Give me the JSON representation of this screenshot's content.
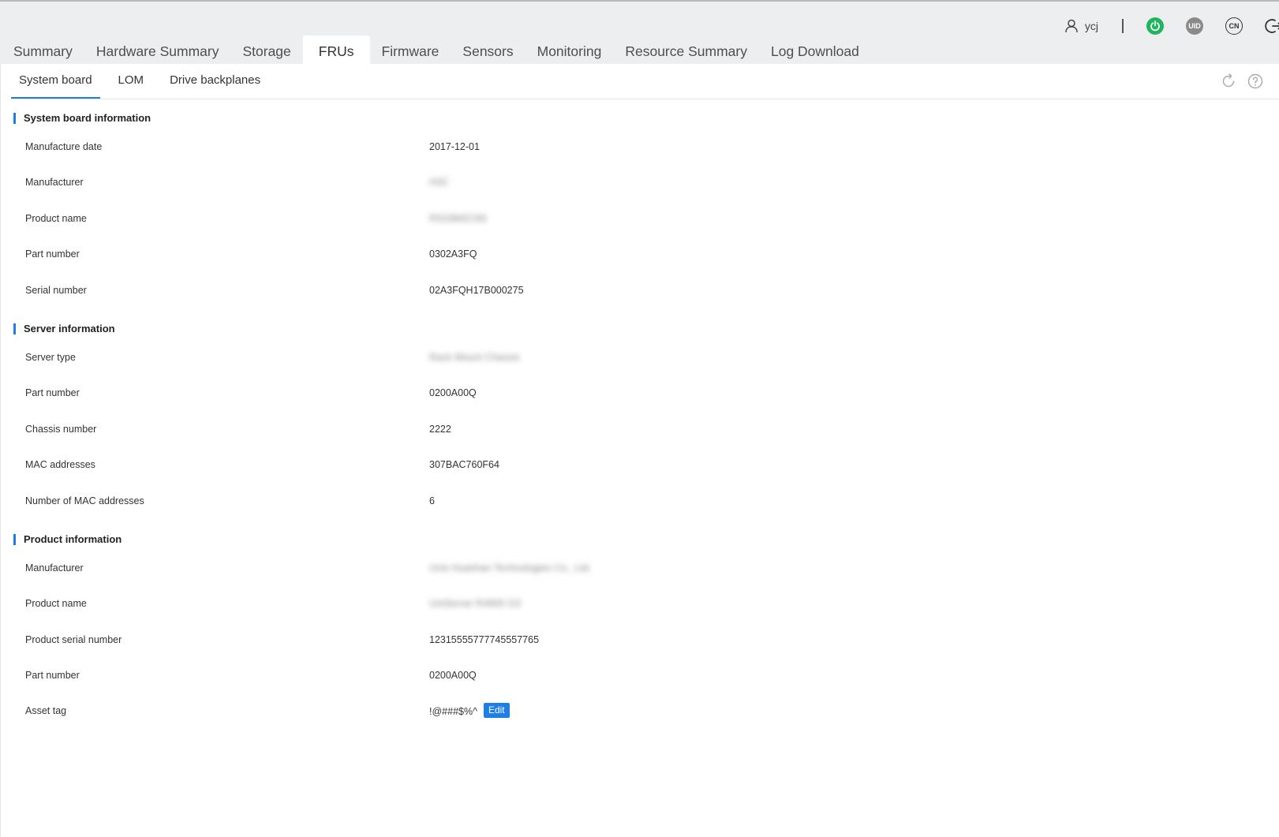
{
  "header": {
    "main_tabs": [
      "Summary",
      "Hardware Summary",
      "Storage",
      "FRUs",
      "Firmware",
      "Sensors",
      "Monitoring",
      "Resource Summary",
      "Log Download"
    ],
    "active_tab": "FRUs",
    "user": {
      "name": "ycj",
      "uid_label": "UID",
      "lang_label": "CN"
    }
  },
  "sub_tabs": [
    "System board",
    "LOM",
    "Drive backplanes"
  ],
  "active_sub_tab": "System board",
  "sections": [
    {
      "title": "System board information",
      "rows": [
        {
          "label": "Manufacture date",
          "value": "2017-12-01"
        },
        {
          "label": "Manufacturer",
          "value": "H3C",
          "obscured": true
        },
        {
          "label": "Product name",
          "value": "RS33M2C9S",
          "obscured": true
        },
        {
          "label": "Part number",
          "value": "0302A3FQ"
        },
        {
          "label": "Serial number",
          "value": "02A3FQH17B000275"
        }
      ]
    },
    {
      "title": "Server information",
      "rows": [
        {
          "label": "Server type",
          "value": "Rack Mount Chassis",
          "obscured": true
        },
        {
          "label": "Part number",
          "value": "0200A00Q"
        },
        {
          "label": "Chassis number",
          "value": "2222"
        },
        {
          "label": "MAC addresses",
          "value": "307BAC760F64"
        },
        {
          "label": "Number of MAC addresses",
          "value": "6"
        }
      ]
    },
    {
      "title": "Product information",
      "rows": [
        {
          "label": "Manufacturer",
          "value": "Unis Huashan Technologies Co., Ltd.",
          "obscured": true
        },
        {
          "label": "Product name",
          "value": "UniServer R4900 G3",
          "obscured": true
        },
        {
          "label": "Product serial number",
          "value": "12315555777745557765"
        },
        {
          "label": "Part number",
          "value": "0200A00Q"
        },
        {
          "label": "Asset tag",
          "value": "!@###$%^",
          "action": "Edit"
        }
      ]
    }
  ],
  "colors": {
    "accent": "#1d7fe5",
    "power": "#1fb55e",
    "header_bg": "#edeeef"
  }
}
